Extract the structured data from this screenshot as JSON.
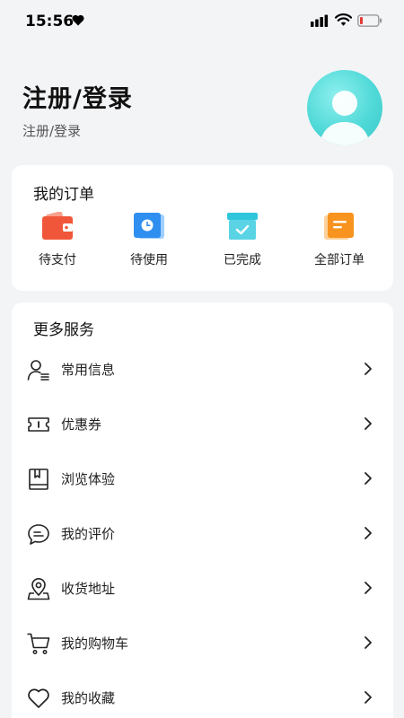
{
  "status_bar": {
    "time": "15:56"
  },
  "profile": {
    "title": "注册/登录",
    "subtitle": "注册/登录"
  },
  "orders": {
    "title": "我的订单",
    "items": [
      {
        "label": "待支付",
        "icon": "wallet-icon"
      },
      {
        "label": "待使用",
        "icon": "clock-card-icon"
      },
      {
        "label": "已完成",
        "icon": "check-box-icon"
      },
      {
        "label": "全部订单",
        "icon": "document-icon"
      }
    ]
  },
  "services": {
    "title": "更多服务",
    "items": [
      {
        "label": "常用信息",
        "icon": "user-info-icon"
      },
      {
        "label": "优惠券",
        "icon": "ticket-icon"
      },
      {
        "label": "浏览体验",
        "icon": "book-icon"
      },
      {
        "label": "我的评价",
        "icon": "chat-icon"
      },
      {
        "label": "收货地址",
        "icon": "map-pin-icon"
      },
      {
        "label": "我的购物车",
        "icon": "cart-icon"
      },
      {
        "label": "我的收藏",
        "icon": "heart-icon"
      }
    ]
  },
  "colors": {
    "wallet": "#f0573a",
    "clock_card": "#2f8ff0",
    "check_box": "#2fc6dc",
    "document": "#f7931e",
    "avatar": "#4fd9d8",
    "battery_low": "#e53935"
  }
}
